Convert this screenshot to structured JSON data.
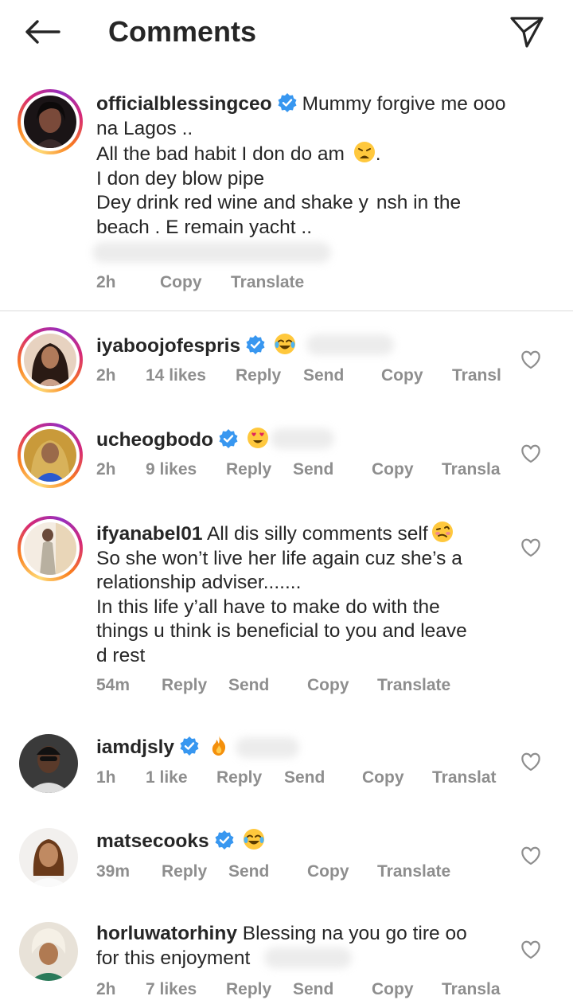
{
  "header": {
    "title": "Comments",
    "back_icon": "arrow-left-icon",
    "share_icon": "paper-plane-icon"
  },
  "caption": {
    "username": "officialblessingceo",
    "text_line1": "Mummy forgive me ooo",
    "text_line2": "na Lagos ..",
    "text_line3": "All the bad habit I don do am",
    "text_line3_end": ".",
    "text_line4": "I don dey blow pipe",
    "text_line5a": "Dey drink red wine and shake y",
    "text_line5b": "nsh in the",
    "text_line6": "beach . E remain yacht ..",
    "time": "2h",
    "copy": "Copy",
    "translate": "Translate"
  },
  "comments": [
    {
      "username": "iyaboojofespris",
      "time": "2h",
      "likes": "14 likes",
      "reply": "Reply",
      "send": "Send",
      "copy": "Copy",
      "translate": "Transl"
    },
    {
      "username": "ucheogbodo",
      "time": "2h",
      "likes": "9 likes",
      "reply": "Reply",
      "send": "Send",
      "copy": "Copy",
      "translate": "Transla"
    },
    {
      "username": "ifyanabel01",
      "text_line1": "All dis silly comments self",
      "text_line2": "So she won’t live her life again cuz she’s a",
      "text_line3": "relationship adviser.......",
      "text_line4": "In this life y’all have to make do with the",
      "text_line5": "things u think is beneficial to you and leave",
      "text_line6": "d rest",
      "time": "54m",
      "reply": "Reply",
      "send": "Send",
      "copy": "Copy",
      "translate": "Translate"
    },
    {
      "username": "iamdjsly",
      "time": "1h",
      "likes": "1 like",
      "reply": "Reply",
      "send": "Send",
      "copy": "Copy",
      "translate": "Translat"
    },
    {
      "username": "matsecooks",
      "time": "39m",
      "reply": "Reply",
      "send": "Send",
      "copy": "Copy",
      "translate": "Translate"
    },
    {
      "username": "horluwatorhiny",
      "text_line1": "Blessing na you go tire oo",
      "text_line2": "for this enjoyment",
      "time": "2h",
      "likes": "7 likes",
      "reply": "Reply",
      "send": "Send",
      "copy": "Copy",
      "translate": "Transla"
    }
  ],
  "colors": {
    "text": "#262626",
    "secondary": "#8e8e8e",
    "verified": "#3897f0",
    "divider": "#dbdbdb"
  }
}
